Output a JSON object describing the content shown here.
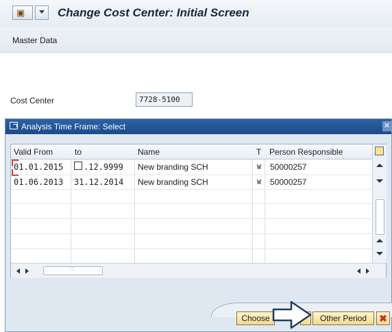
{
  "title_bar": {
    "title": "Change Cost Center: Initial Screen",
    "menu_icon": "sap-menu-icon",
    "dropdown_icon": "chevron-down-icon"
  },
  "app_bar": {
    "items": [
      "Master Data"
    ]
  },
  "form": {
    "cost_center_label": "Cost Center",
    "cost_center_value": "7728-5100"
  },
  "dialog": {
    "title": "Analysis Time Frame: Select",
    "title_icon": "window-arrow-icon",
    "close_icon": "close-icon",
    "columns": [
      "Valid From",
      "to",
      "Name",
      "T",
      "Person Responsible"
    ],
    "rows": [
      {
        "valid_from": "01.01.2015",
        "to": ".12.9999",
        "name": "New branding SCH",
        "type": "W",
        "person": "50000257"
      },
      {
        "valid_from": "01.06.2013",
        "to": "31.12.2014",
        "name": "New branding SCH",
        "type": "W",
        "person": "50000257"
      }
    ],
    "hscroll_grip": ":::",
    "buttons": {
      "choose": "Choose",
      "other_period": "Other Period"
    },
    "column_settings_icon": "column-settings-icon",
    "cancel_icon": "cancel-x-icon"
  },
  "colors": {
    "title_text": "#15273f",
    "dialog_title_bg": "#2e62a6",
    "button_bg": "#f2d98e",
    "cancel_x": "#d62b1f"
  }
}
